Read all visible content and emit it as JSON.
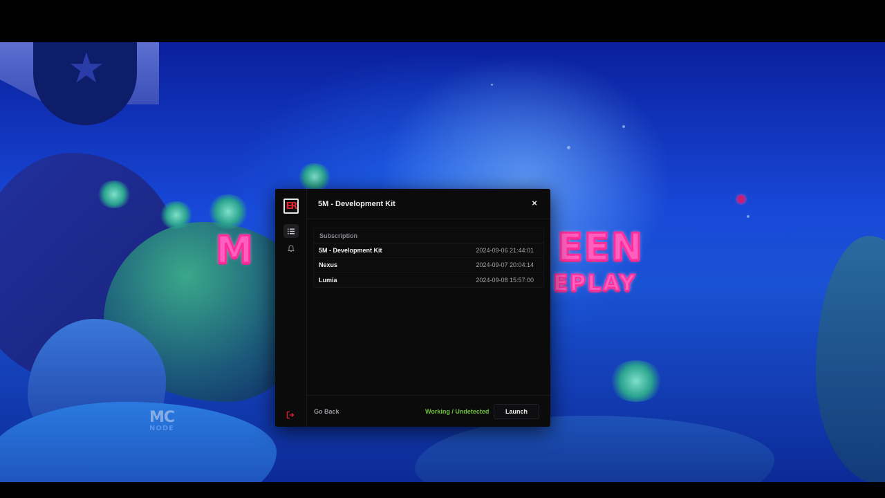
{
  "background": {
    "title_line1": "M",
    "title_line1b": "EEN",
    "title_line2": "EPLAY",
    "watermark_top": "MC",
    "watermark_bottom": "NODE"
  },
  "window": {
    "logo_text": "ER",
    "title": "5M - Development Kit",
    "close_glyph": "×",
    "sidebar": {
      "items": [
        {
          "icon": "list-icon",
          "active": true
        },
        {
          "icon": "bell-icon",
          "active": false
        }
      ],
      "logout_icon": "logout-icon"
    },
    "table": {
      "header": "Subscription",
      "rows": [
        {
          "name": "5M - Development Kit",
          "date": "2024-09-06 21:44:01"
        },
        {
          "name": "Nexus",
          "date": "2024-09-07 20:04:14"
        },
        {
          "name": "Lumia",
          "date": "2024-09-08 15:57:00"
        }
      ]
    },
    "footer": {
      "go_back": "Go Back",
      "status": "Working / Undetected",
      "launch": "Launch"
    }
  },
  "colors": {
    "accent_red": "#e0212e",
    "status_green": "#6fc23a",
    "window_bg": "#0b0b0c"
  }
}
